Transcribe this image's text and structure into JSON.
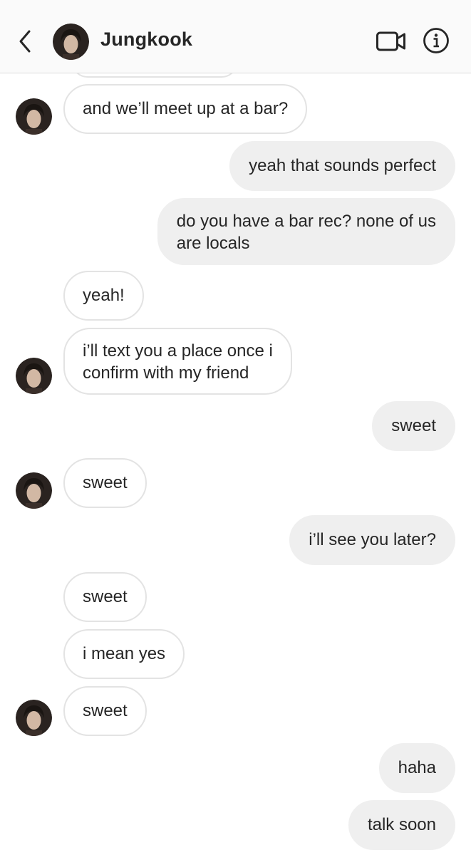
{
  "header": {
    "contact_name": "Jungkook",
    "icons": {
      "back": "chevron-left-icon",
      "video": "video-camera-icon",
      "info": "info-icon"
    }
  },
  "messages": [
    {
      "sender": "them",
      "text": ""
    },
    {
      "sender": "them",
      "text": "and we’ll meet up at a bar?"
    },
    {
      "sender": "me",
      "text": "yeah that sounds perfect"
    },
    {
      "sender": "me",
      "text": "do you have a bar rec? none of us are locals",
      "lines": [
        "do you have a bar rec? none of us",
        "are locals"
      ]
    },
    {
      "sender": "them",
      "text": "yeah!"
    },
    {
      "sender": "them",
      "text": "i’ll text you a place once i confirm with my friend",
      "lines": [
        "i’ll text you a place once i",
        "confirm with my friend"
      ]
    },
    {
      "sender": "me",
      "text": "sweet"
    },
    {
      "sender": "them",
      "text": "sweet"
    },
    {
      "sender": "me",
      "text": "i’ll see you later?"
    },
    {
      "sender": "them",
      "text": "sweet"
    },
    {
      "sender": "them",
      "text": "i mean yes"
    },
    {
      "sender": "them",
      "text": "sweet"
    },
    {
      "sender": "me",
      "text": "haha"
    },
    {
      "sender": "me",
      "text": "talk soon"
    }
  ]
}
